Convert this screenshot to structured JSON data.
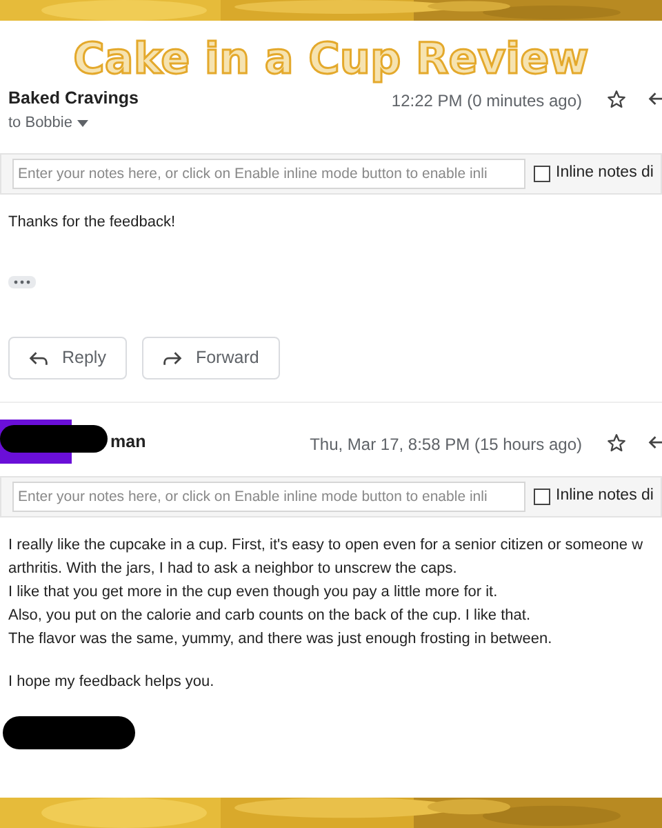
{
  "title": "Cake in a Cup Review",
  "messages": [
    {
      "sender": "Baked Cravings",
      "sender_redacted": false,
      "recipient": "to Bobbie",
      "time": "12:22 PM (0 minutes ago)",
      "starred": false,
      "notes": {
        "placeholder": "Enter your notes here, or click on Enable inline mode button to enable inli"
      },
      "inline_notes": {
        "label": "Inline notes di",
        "checked": false
      },
      "paragraphs": [
        [
          "Thanks for the feedback!"
        ]
      ],
      "show_trimmed": true,
      "actions": [
        "Reply",
        "Forward"
      ],
      "signature_redacted": false
    },
    {
      "sender": "man",
      "sender_redacted": true,
      "time": "Thu, Mar 17, 8:58 PM (15 hours ago)",
      "starred": false,
      "notes": {
        "placeholder": "Enter your notes here, or click on Enable inline mode button to enable inli"
      },
      "inline_notes": {
        "label": "Inline notes di",
        "checked": false
      },
      "paragraphs": [
        [
          "I really like the cupcake in a cup. First, it's easy to open even for a senior citizen or someone w",
          "arthritis. With the jars, I had to ask a neighbor to unscrew the caps.",
          "I like that you get more in the cup even though you pay a little more for it.",
          "Also, you put on the calorie and carb counts on the back of the cup. I like that.",
          "The flavor was the same, yummy, and there was just enough frosting in between."
        ],
        [
          "I hope my feedback helps you."
        ]
      ],
      "show_trimmed": false,
      "signature_redacted": true
    }
  ]
}
